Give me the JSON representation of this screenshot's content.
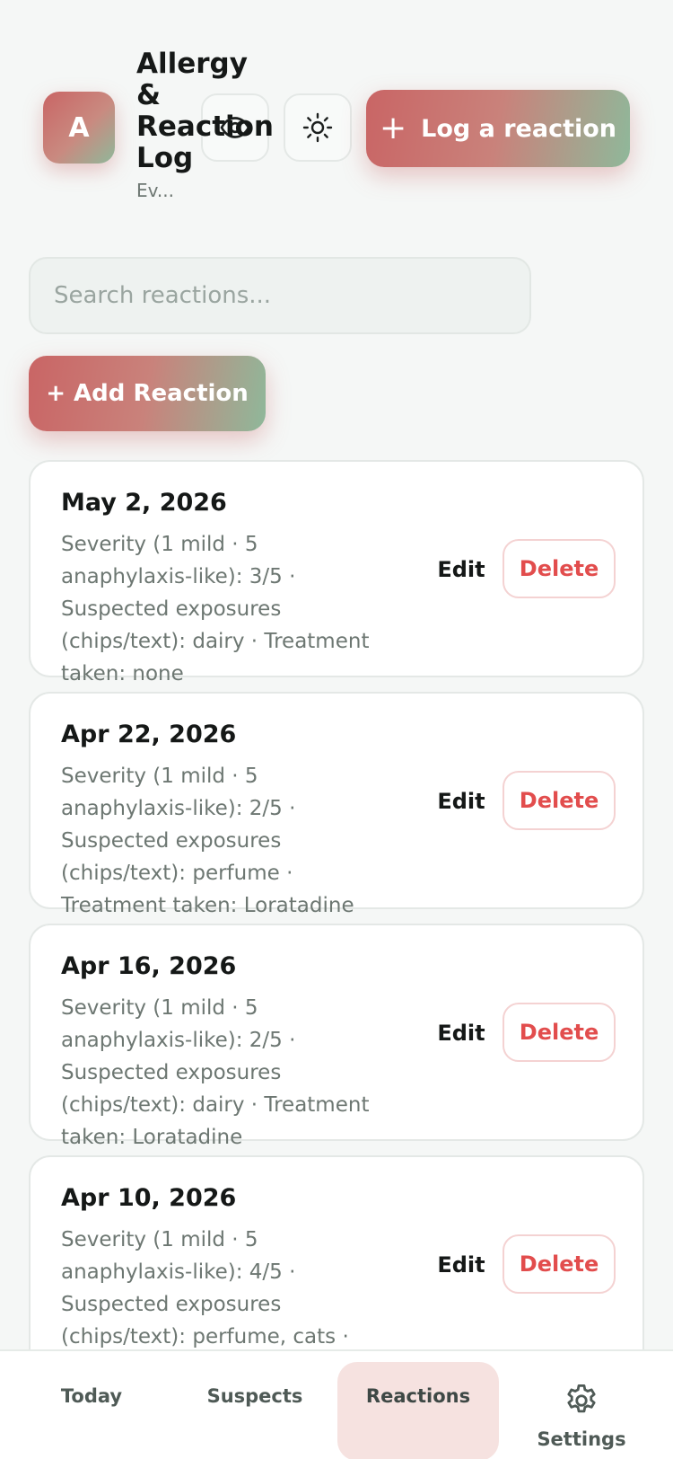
{
  "header": {
    "avatar_letter": "A",
    "title": "Allergy & Reaction Log",
    "subtitle": "Ev...",
    "log_button_label": "Log a reaction",
    "privacy_icon": "eye-icon",
    "theme_icon": "sun-icon"
  },
  "search": {
    "placeholder": "Search reactions..."
  },
  "add_button_label": "+ Add Reaction",
  "reactions": [
    {
      "date": "May 2, 2026",
      "description": "Severity (1 mild · 5 anaphylaxis-like): 3/5 · Suspected exposures (chips/text): dairy · Treatment taken: none",
      "edit_label": "Edit",
      "delete_label": "Delete"
    },
    {
      "date": "Apr 22, 2026",
      "description": "Severity (1 mild · 5 anaphylaxis-like): 2/5 · Suspected exposures (chips/text): perfume · Treatment taken: Loratadine",
      "edit_label": "Edit",
      "delete_label": "Delete"
    },
    {
      "date": "Apr 16, 2026",
      "description": "Severity (1 mild · 5 anaphylaxis-like): 2/5 · Suspected exposures (chips/text): dairy · Treatment taken: Loratadine",
      "edit_label": "Edit",
      "delete_label": "Delete"
    },
    {
      "date": "Apr 10, 2026",
      "description": "Severity (1 mild · 5 anaphylaxis-like): 4/5 · Suspected exposures (chips/text): perfume, cats · Treatment taken: Loperamide",
      "edit_label": "Edit",
      "delete_label": "Delete"
    }
  ],
  "nav": {
    "items": [
      {
        "label": "Today"
      },
      {
        "label": "Suspects"
      },
      {
        "label": "Reactions",
        "active": true
      },
      {
        "label": "Settings",
        "icon": "gear-icon"
      }
    ]
  },
  "colors": {
    "accent_red": "#c96565",
    "accent_green": "#8fb89a",
    "delete_red": "#e24d4d",
    "active_tab_bg": "#f6e2e0"
  }
}
